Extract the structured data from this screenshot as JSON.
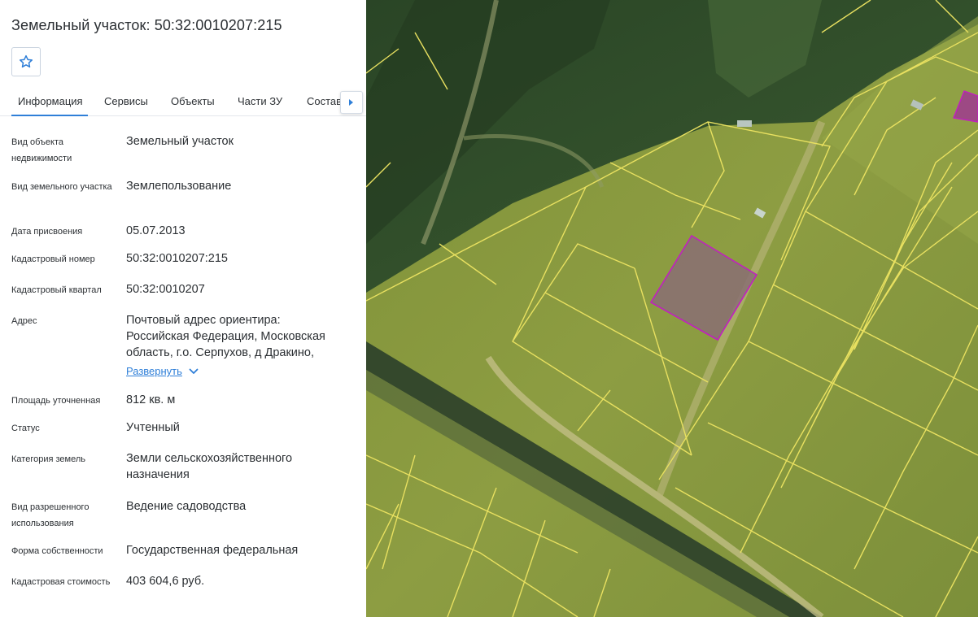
{
  "object": {
    "title": "Земельный участок: 50:32:0010207:215"
  },
  "tabs": [
    {
      "label": "Информация",
      "active": true
    },
    {
      "label": "Сервисы",
      "active": false
    },
    {
      "label": "Объекты",
      "active": false
    },
    {
      "label": "Части ЗУ",
      "active": false
    },
    {
      "label": "Состав",
      "active": false
    }
  ],
  "fields": [
    {
      "label": "Вид объекта недвижимости",
      "value": "Земельный участок"
    },
    {
      "label": "Вид земельного участка",
      "value": "Землепользование"
    },
    {
      "label": "Дата присвоения",
      "value": "05.07.2013"
    },
    {
      "label": "Кадастровый номер",
      "value": "50:32:0010207:215"
    },
    {
      "label": "Кадастровый квартал",
      "value": "50:32:0010207"
    },
    {
      "label": "Адрес",
      "value": "Почтовый адрес ориентира: Российская Федерация, Московская область, г.о. Серпухов, д Дракино,"
    },
    {
      "label": "Площадь уточненная",
      "value": "812 кв. м"
    },
    {
      "label": "Статус",
      "value": "Учтенный"
    },
    {
      "label": "Категория земель",
      "value": "Земли сельскохозяйственного назначения"
    },
    {
      "label": "Вид разрешенного использования",
      "value": "Ведение садоводства"
    },
    {
      "label": "Форма собственности",
      "value": "Государственная федеральная"
    },
    {
      "label": "Кадастровая стоимость",
      "value": "403 604,6 руб."
    }
  ],
  "address_expand_label": "Развернуть",
  "colors": {
    "accent": "#2f7fd8",
    "parcel_border": "#f0e060",
    "selected_parcel": "#c21fc0",
    "field_green": "#8a9a3c",
    "forest": "#2e4a2a"
  },
  "icons": {
    "favorite": "star-outline-icon",
    "tabs_scroll": "triangle-right-icon",
    "expand": "chevron-down-icon"
  }
}
